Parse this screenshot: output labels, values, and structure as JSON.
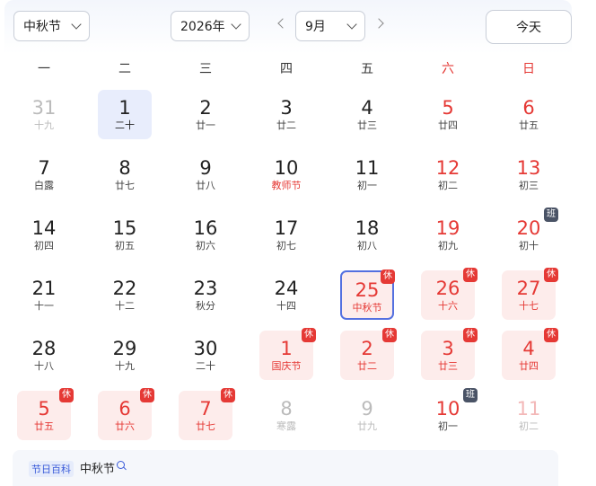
{
  "header": {
    "festival_select": "中秋节",
    "year_select": "2026年",
    "month_select": "9月",
    "today_button": "今天"
  },
  "weekdays": [
    "一",
    "二",
    "三",
    "四",
    "五",
    "六",
    "日"
  ],
  "badges": {
    "rest": "休",
    "work": "班"
  },
  "colors": {
    "holiday_red": "#e53935",
    "selected_border": "#5470e0",
    "today_bg": "#e8edfc",
    "holiday_bg": "#fdeceb"
  },
  "weeks": [
    [
      {
        "d": "31",
        "l": "十九",
        "other": true
      },
      {
        "d": "1",
        "l": "二十",
        "today": true
      },
      {
        "d": "2",
        "l": "廿一"
      },
      {
        "d": "3",
        "l": "廿二"
      },
      {
        "d": "4",
        "l": "廿三"
      },
      {
        "d": "5",
        "l": "廿四"
      },
      {
        "d": "6",
        "l": "廿五"
      }
    ],
    [
      {
        "d": "7",
        "l": "白露"
      },
      {
        "d": "8",
        "l": "廿七"
      },
      {
        "d": "9",
        "l": "廿八"
      },
      {
        "d": "10",
        "l": "教师节"
      },
      {
        "d": "11",
        "l": "初一"
      },
      {
        "d": "12",
        "l": "初二"
      },
      {
        "d": "13",
        "l": "初三"
      }
    ],
    [
      {
        "d": "14",
        "l": "初四"
      },
      {
        "d": "15",
        "l": "初五"
      },
      {
        "d": "16",
        "l": "初六"
      },
      {
        "d": "17",
        "l": "初七"
      },
      {
        "d": "18",
        "l": "初八"
      },
      {
        "d": "19",
        "l": "初九"
      },
      {
        "d": "20",
        "l": "初十",
        "badge": "work"
      }
    ],
    [
      {
        "d": "21",
        "l": "十一"
      },
      {
        "d": "22",
        "l": "十二"
      },
      {
        "d": "23",
        "l": "秋分"
      },
      {
        "d": "24",
        "l": "十四"
      },
      {
        "d": "25",
        "l": "中秋节",
        "holiday": true,
        "selected": true,
        "badge": "rest"
      },
      {
        "d": "26",
        "l": "十六",
        "holiday": true,
        "badge": "rest"
      },
      {
        "d": "27",
        "l": "十七",
        "holiday": true,
        "badge": "rest"
      }
    ],
    [
      {
        "d": "28",
        "l": "十八"
      },
      {
        "d": "29",
        "l": "十九"
      },
      {
        "d": "30",
        "l": "二十"
      },
      {
        "d": "1",
        "l": "国庆节",
        "holiday": true,
        "badge": "rest"
      },
      {
        "d": "2",
        "l": "廿二",
        "holiday": true,
        "badge": "rest"
      },
      {
        "d": "3",
        "l": "廿三",
        "holiday": true,
        "badge": "rest"
      },
      {
        "d": "4",
        "l": "廿四",
        "holiday": true,
        "badge": "rest"
      }
    ],
    [
      {
        "d": "5",
        "l": "廿五",
        "holiday": true,
        "badge": "rest"
      },
      {
        "d": "6",
        "l": "廿六",
        "holiday": true,
        "badge": "rest"
      },
      {
        "d": "7",
        "l": "廿七",
        "holiday": true,
        "badge": "rest"
      },
      {
        "d": "8",
        "l": "寒露",
        "other": true
      },
      {
        "d": "9",
        "l": "廿九",
        "other": true
      },
      {
        "d": "10",
        "l": "初一",
        "badge": "work"
      },
      {
        "d": "11",
        "l": "初二",
        "other": true
      }
    ]
  ],
  "footer": {
    "tag": "节日百科",
    "festival": "中秋节"
  }
}
